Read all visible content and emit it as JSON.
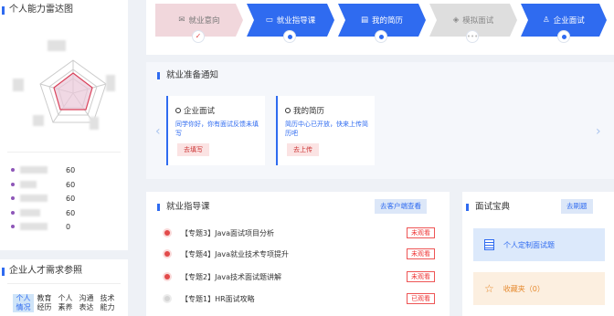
{
  "sidebar": {
    "radar_title": "个人能力雷达图",
    "scores": [
      "60",
      "60",
      "60",
      "60",
      "0"
    ],
    "talent_title": "企业人才需求参照",
    "talent_tabs": [
      {
        "l1": "个人",
        "l2": "情况"
      },
      {
        "l1": "教育",
        "l2": "经历"
      },
      {
        "l1": "个人",
        "l2": "素养"
      },
      {
        "l1": "沟通",
        "l2": "表达"
      },
      {
        "l1": "技术",
        "l2": "能力"
      }
    ]
  },
  "steps": [
    {
      "label": "就业意向",
      "icon": "✉",
      "state": "done"
    },
    {
      "label": "就业指导课",
      "icon": "▭",
      "state": "active"
    },
    {
      "label": "我的简历",
      "icon": "▤",
      "state": "active"
    },
    {
      "label": "模拟面试",
      "icon": "◈",
      "state": "pending"
    },
    {
      "label": "企业面试",
      "icon": "♙",
      "state": "active"
    }
  ],
  "notice": {
    "title": "就业准备通知",
    "cards": [
      {
        "title": "企业面试",
        "desc": "同学你好，你有面试反馈未填写",
        "button": "去填写"
      },
      {
        "title": "我的简历",
        "desc": "简历中心已开放，快来上传简历吧",
        "button": "去上传"
      }
    ]
  },
  "courses": {
    "title": "就业指导课",
    "action": "去客户端查看",
    "items": [
      {
        "text": "【专题3】Java面试项目分析",
        "status": "未观看"
      },
      {
        "text": "【专题4】Java就业技术专项提升",
        "status": "未观看"
      },
      {
        "text": "【专题2】Java技术面试题讲解",
        "status": "未观看"
      },
      {
        "text": "【专题1】HR面试攻略",
        "status": "已观看"
      }
    ]
  },
  "interview": {
    "title": "面试宝典",
    "action": "去刷题",
    "custom": "个人定制面试题",
    "favorites": "收藏夹（0）"
  }
}
